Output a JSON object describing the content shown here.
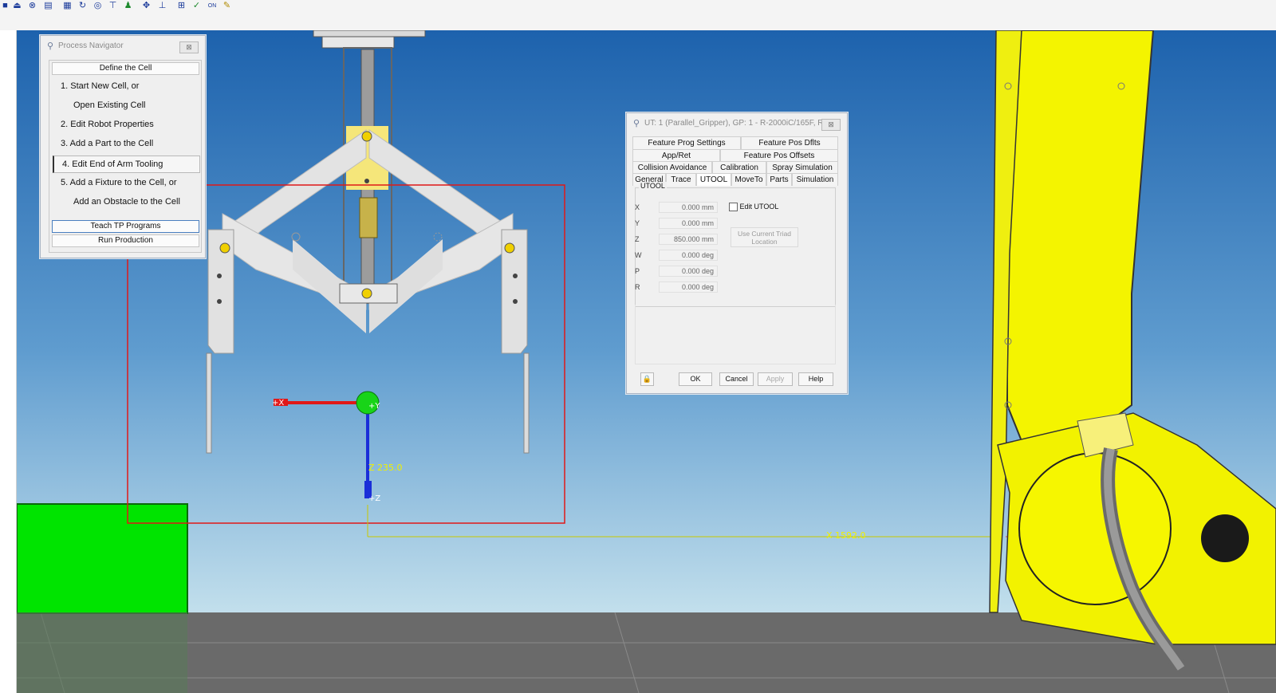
{
  "toolbar": {
    "icons": [
      "stop-icon",
      "eject-icon",
      "close-circle-icon",
      "grid-icon",
      "cell-icon",
      "cycle-icon",
      "target-icon",
      "pin-icon",
      "person-icon",
      "pan-icon",
      "measure-icon",
      "frame-icon",
      "check-icon",
      "online-icon",
      "teach-icon"
    ],
    "glyphs": [
      "■",
      "⏏",
      "⊗",
      "▤",
      "▦",
      "↻",
      "◎",
      "⊤",
      "♟",
      "✥",
      "⊥",
      "⊞",
      "✓",
      "ON",
      "✎"
    ]
  },
  "scene": {
    "z_readout": "Z 235.0",
    "x_readout": "X 1592.0",
    "triad_x_label": "+X",
    "triad_y_label": "+Y",
    "triad_z_label": "+Z",
    "colors": {
      "sky_top": "#1e64b0",
      "sky_bottom": "#bfdcea",
      "floor": "#6b6b6b",
      "robot": "#f2f200",
      "part": "#00e000",
      "gripper": "#e6e6e6",
      "selection": "#e02020"
    }
  },
  "process_navigator": {
    "title": "Process Navigator",
    "close_glyph": "⊠",
    "buttons": {
      "define": "Define the Cell",
      "teach": "Teach TP Programs",
      "run": "Run Production"
    },
    "steps": [
      "1.  Start New Cell, or",
      "Open Existing Cell",
      "2.  Edit Robot Properties",
      "3.  Add a Part to the Cell",
      "4.  Edit End of Arm Tooling",
      "5.  Add a Fixture to the Cell, or",
      "Add an Obstacle to the Cell"
    ]
  },
  "utool_dialog": {
    "title": "UT: 1 (Parallel_Gripper), GP: 1 - R-2000iC/165F, Ro...",
    "close_glyph": "⊠",
    "tab_rows": [
      [
        "Feature Prog Settings",
        "Feature Pos Dflts"
      ],
      [
        "App/Ret",
        "Feature Pos Offsets"
      ],
      [
        "Collision Avoidance",
        "Calibration",
        "Spray Simulation"
      ],
      [
        "General",
        "Trace",
        "UTOOL",
        "MoveTo",
        "Parts",
        "Simulation"
      ]
    ],
    "active_tab": "UTOOL",
    "group_label": "UTOOL",
    "fields": [
      {
        "label": "X",
        "value": "0.000 mm"
      },
      {
        "label": "Y",
        "value": "0.000 mm"
      },
      {
        "label": "Z",
        "value": "850.000 mm"
      },
      {
        "label": "W",
        "value": "0.000 deg"
      },
      {
        "label": "P",
        "value": "0.000 deg"
      },
      {
        "label": "R",
        "value": "0.000 deg"
      }
    ],
    "edit_utool_label": "Edit UTOOL",
    "use_triad_line1": "Use Current Triad",
    "use_triad_line2": "Location",
    "buttons": {
      "ok": "OK",
      "cancel": "Cancel",
      "apply": "Apply",
      "help": "Help"
    },
    "lock_glyph": "🔒"
  }
}
